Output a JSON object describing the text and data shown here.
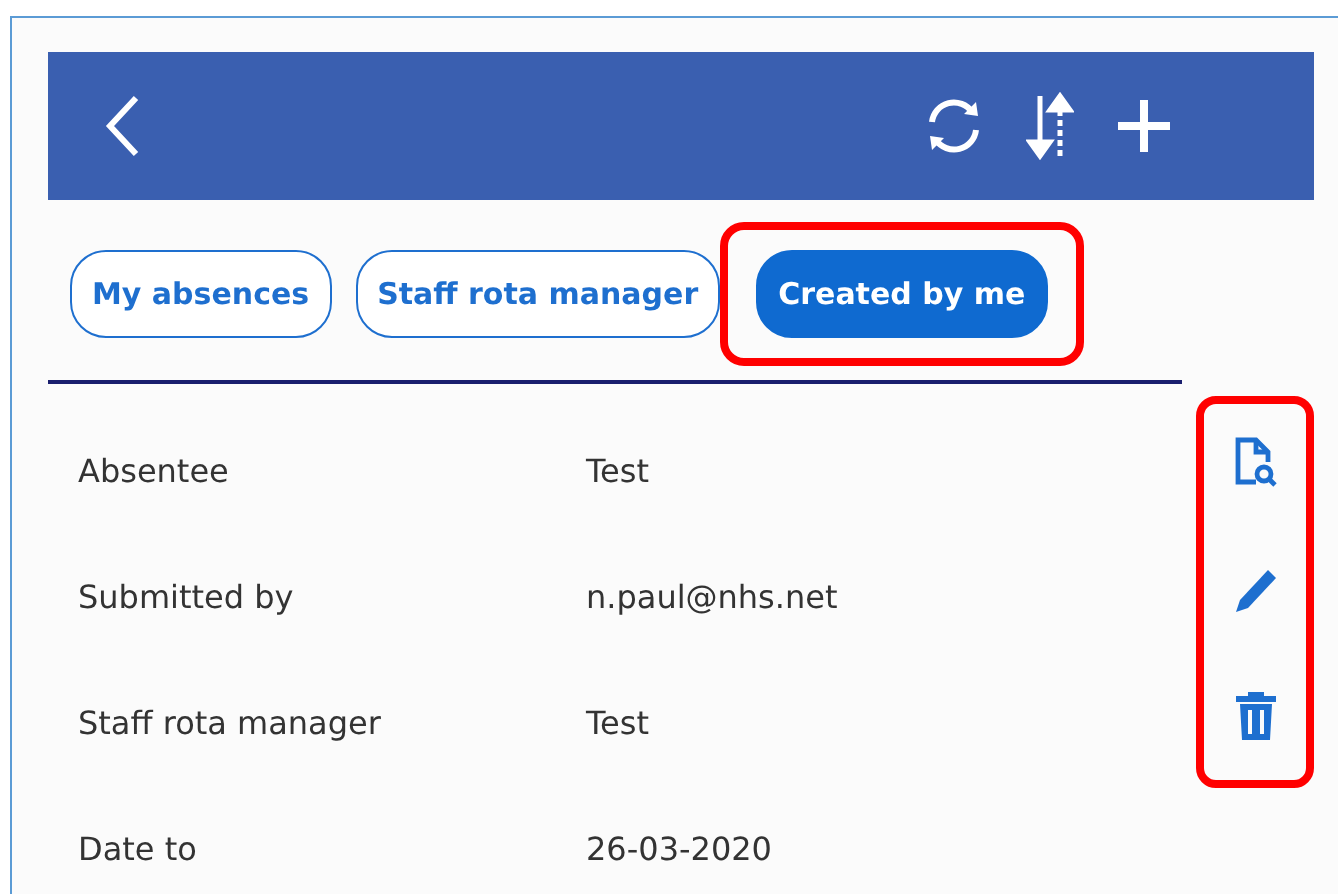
{
  "tabs": [
    {
      "label": "My absences",
      "selected": false
    },
    {
      "label": "Staff rota manager",
      "selected": false
    },
    {
      "label": "Created by me",
      "selected": true
    }
  ],
  "fields": [
    {
      "label": "Absentee",
      "value": "Test"
    },
    {
      "label": "Submitted by",
      "value": "n.paul@nhs.net"
    },
    {
      "label": "Staff rota manager",
      "value": "Test"
    },
    {
      "label": "Date to",
      "value": "26-03-2020"
    }
  ],
  "actions": [
    {
      "kind": "view"
    },
    {
      "kind": "edit"
    },
    {
      "kind": "delete"
    }
  ]
}
